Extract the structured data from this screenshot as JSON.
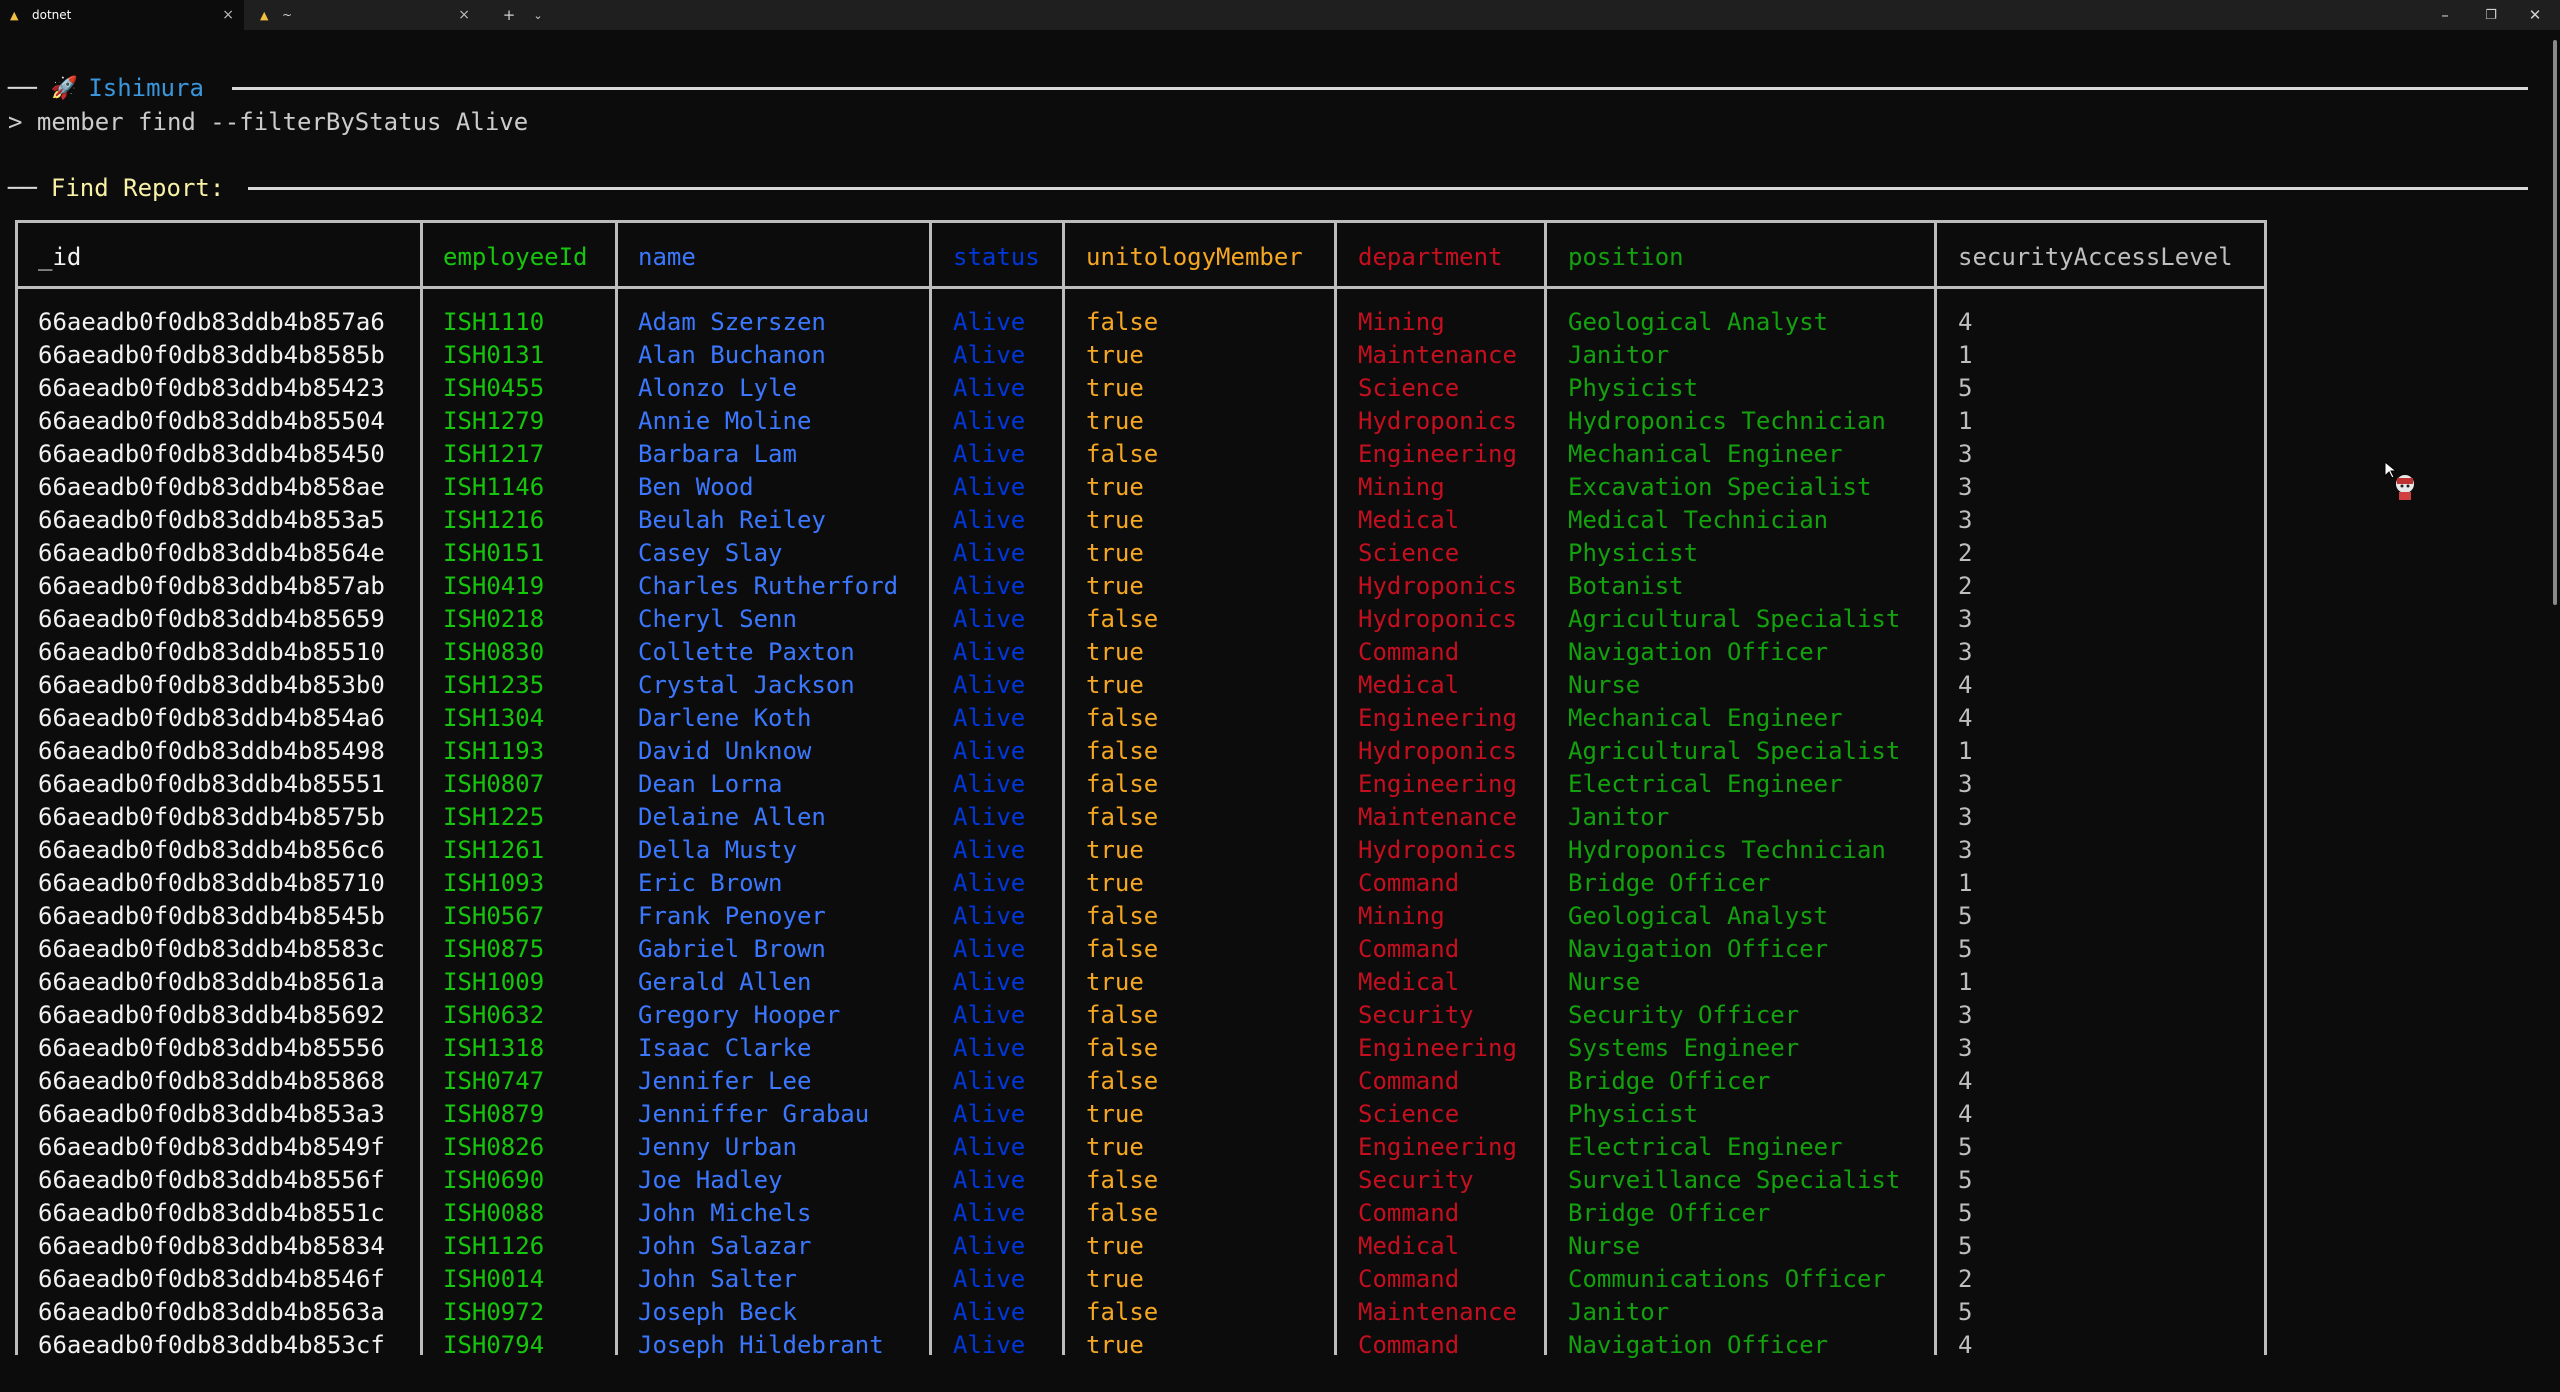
{
  "tabs": [
    {
      "title": "dotnet",
      "close": "×"
    },
    {
      "title": "~",
      "close": "×"
    }
  ],
  "window_controls": {
    "new_tab": "+",
    "dropdown": "⌄",
    "minimize": "–",
    "maximize": "❐",
    "close": "✕"
  },
  "banner": {
    "title": "Ishimura",
    "dash_left": "──"
  },
  "command": {
    "prompt": ">",
    "text": " member find --filterByStatus Alive"
  },
  "report": {
    "label": "Find Report:",
    "dash_left": "──"
  },
  "colors": {
    "id": "#f2f2f2",
    "employeeId": "#16c60c",
    "name": "#3b78ff",
    "status": "#0037da",
    "unitologyMember": "#f5a623",
    "department": "#c50f1f",
    "position": "#13a10e",
    "securityAccessLevel": "#bfbfbf"
  },
  "table": {
    "columns": [
      "_id",
      "employeeId",
      "name",
      "status",
      "unitologyMember",
      "department",
      "position",
      "securityAccessLevel"
    ],
    "rows": [
      [
        "66aeadb0f0db83ddb4b857a6",
        "ISH1110",
        "Adam Szerszen",
        "Alive",
        "false",
        "Mining",
        "Geological Analyst",
        "4"
      ],
      [
        "66aeadb0f0db83ddb4b8585b",
        "ISH0131",
        "Alan Buchanon",
        "Alive",
        "true",
        "Maintenance",
        "Janitor",
        "1"
      ],
      [
        "66aeadb0f0db83ddb4b85423",
        "ISH0455",
        "Alonzo Lyle",
        "Alive",
        "true",
        "Science",
        "Physicist",
        "5"
      ],
      [
        "66aeadb0f0db83ddb4b85504",
        "ISH1279",
        "Annie Moline",
        "Alive",
        "true",
        "Hydroponics",
        "Hydroponics Technician",
        "1"
      ],
      [
        "66aeadb0f0db83ddb4b85450",
        "ISH1217",
        "Barbara Lam",
        "Alive",
        "false",
        "Engineering",
        "Mechanical Engineer",
        "3"
      ],
      [
        "66aeadb0f0db83ddb4b858ae",
        "ISH1146",
        "Ben Wood",
        "Alive",
        "true",
        "Mining",
        "Excavation Specialist",
        "3"
      ],
      [
        "66aeadb0f0db83ddb4b853a5",
        "ISH1216",
        "Beulah Reiley",
        "Alive",
        "true",
        "Medical",
        "Medical Technician",
        "3"
      ],
      [
        "66aeadb0f0db83ddb4b8564e",
        "ISH0151",
        "Casey Slay",
        "Alive",
        "true",
        "Science",
        "Physicist",
        "2"
      ],
      [
        "66aeadb0f0db83ddb4b857ab",
        "ISH0419",
        "Charles Rutherford",
        "Alive",
        "true",
        "Hydroponics",
        "Botanist",
        "2"
      ],
      [
        "66aeadb0f0db83ddb4b85659",
        "ISH0218",
        "Cheryl Senn",
        "Alive",
        "false",
        "Hydroponics",
        "Agricultural Specialist",
        "3"
      ],
      [
        "66aeadb0f0db83ddb4b85510",
        "ISH0830",
        "Collette Paxton",
        "Alive",
        "true",
        "Command",
        "Navigation Officer",
        "3"
      ],
      [
        "66aeadb0f0db83ddb4b853b0",
        "ISH1235",
        "Crystal Jackson",
        "Alive",
        "true",
        "Medical",
        "Nurse",
        "4"
      ],
      [
        "66aeadb0f0db83ddb4b854a6",
        "ISH1304",
        "Darlene Koth",
        "Alive",
        "false",
        "Engineering",
        "Mechanical Engineer",
        "4"
      ],
      [
        "66aeadb0f0db83ddb4b85498",
        "ISH1193",
        "David Unknow",
        "Alive",
        "false",
        "Hydroponics",
        "Agricultural Specialist",
        "1"
      ],
      [
        "66aeadb0f0db83ddb4b85551",
        "ISH0807",
        "Dean Lorna",
        "Alive",
        "false",
        "Engineering",
        "Electrical Engineer",
        "3"
      ],
      [
        "66aeadb0f0db83ddb4b8575b",
        "ISH1225",
        "Delaine Allen",
        "Alive",
        "false",
        "Maintenance",
        "Janitor",
        "3"
      ],
      [
        "66aeadb0f0db83ddb4b856c6",
        "ISH1261",
        "Della Musty",
        "Alive",
        "true",
        "Hydroponics",
        "Hydroponics Technician",
        "3"
      ],
      [
        "66aeadb0f0db83ddb4b85710",
        "ISH1093",
        "Eric Brown",
        "Alive",
        "true",
        "Command",
        "Bridge Officer",
        "1"
      ],
      [
        "66aeadb0f0db83ddb4b8545b",
        "ISH0567",
        "Frank Penoyer",
        "Alive",
        "false",
        "Mining",
        "Geological Analyst",
        "5"
      ],
      [
        "66aeadb0f0db83ddb4b8583c",
        "ISH0875",
        "Gabriel Brown",
        "Alive",
        "false",
        "Command",
        "Navigation Officer",
        "5"
      ],
      [
        "66aeadb0f0db83ddb4b8561a",
        "ISH1009",
        "Gerald Allen",
        "Alive",
        "true",
        "Medical",
        "Nurse",
        "1"
      ],
      [
        "66aeadb0f0db83ddb4b85692",
        "ISH0632",
        "Gregory Hooper",
        "Alive",
        "false",
        "Security",
        "Security Officer",
        "3"
      ],
      [
        "66aeadb0f0db83ddb4b85556",
        "ISH1318",
        "Isaac Clarke",
        "Alive",
        "false",
        "Engineering",
        "Systems Engineer",
        "3"
      ],
      [
        "66aeadb0f0db83ddb4b85868",
        "ISH0747",
        "Jennifer Lee",
        "Alive",
        "false",
        "Command",
        "Bridge Officer",
        "4"
      ],
      [
        "66aeadb0f0db83ddb4b853a3",
        "ISH0879",
        "Jenniffer Grabau",
        "Alive",
        "true",
        "Science",
        "Physicist",
        "4"
      ],
      [
        "66aeadb0f0db83ddb4b8549f",
        "ISH0826",
        "Jenny Urban",
        "Alive",
        "true",
        "Engineering",
        "Electrical Engineer",
        "5"
      ],
      [
        "66aeadb0f0db83ddb4b8556f",
        "ISH0690",
        "Joe Hadley",
        "Alive",
        "false",
        "Security",
        "Surveillance Specialist",
        "5"
      ],
      [
        "66aeadb0f0db83ddb4b8551c",
        "ISH0088",
        "John Michels",
        "Alive",
        "false",
        "Command",
        "Bridge Officer",
        "5"
      ],
      [
        "66aeadb0f0db83ddb4b85834",
        "ISH1126",
        "John Salazar",
        "Alive",
        "true",
        "Medical",
        "Nurse",
        "5"
      ],
      [
        "66aeadb0f0db83ddb4b8546f",
        "ISH0014",
        "John Salter",
        "Alive",
        "true",
        "Command",
        "Communications Officer",
        "2"
      ],
      [
        "66aeadb0f0db83ddb4b8563a",
        "ISH0972",
        "Joseph Beck",
        "Alive",
        "false",
        "Maintenance",
        "Janitor",
        "5"
      ],
      [
        "66aeadb0f0db83ddb4b853cf",
        "ISH0794",
        "Joseph Hildebrant",
        "Alive",
        "true",
        "Command",
        "Navigation Officer",
        "4"
      ]
    ]
  }
}
